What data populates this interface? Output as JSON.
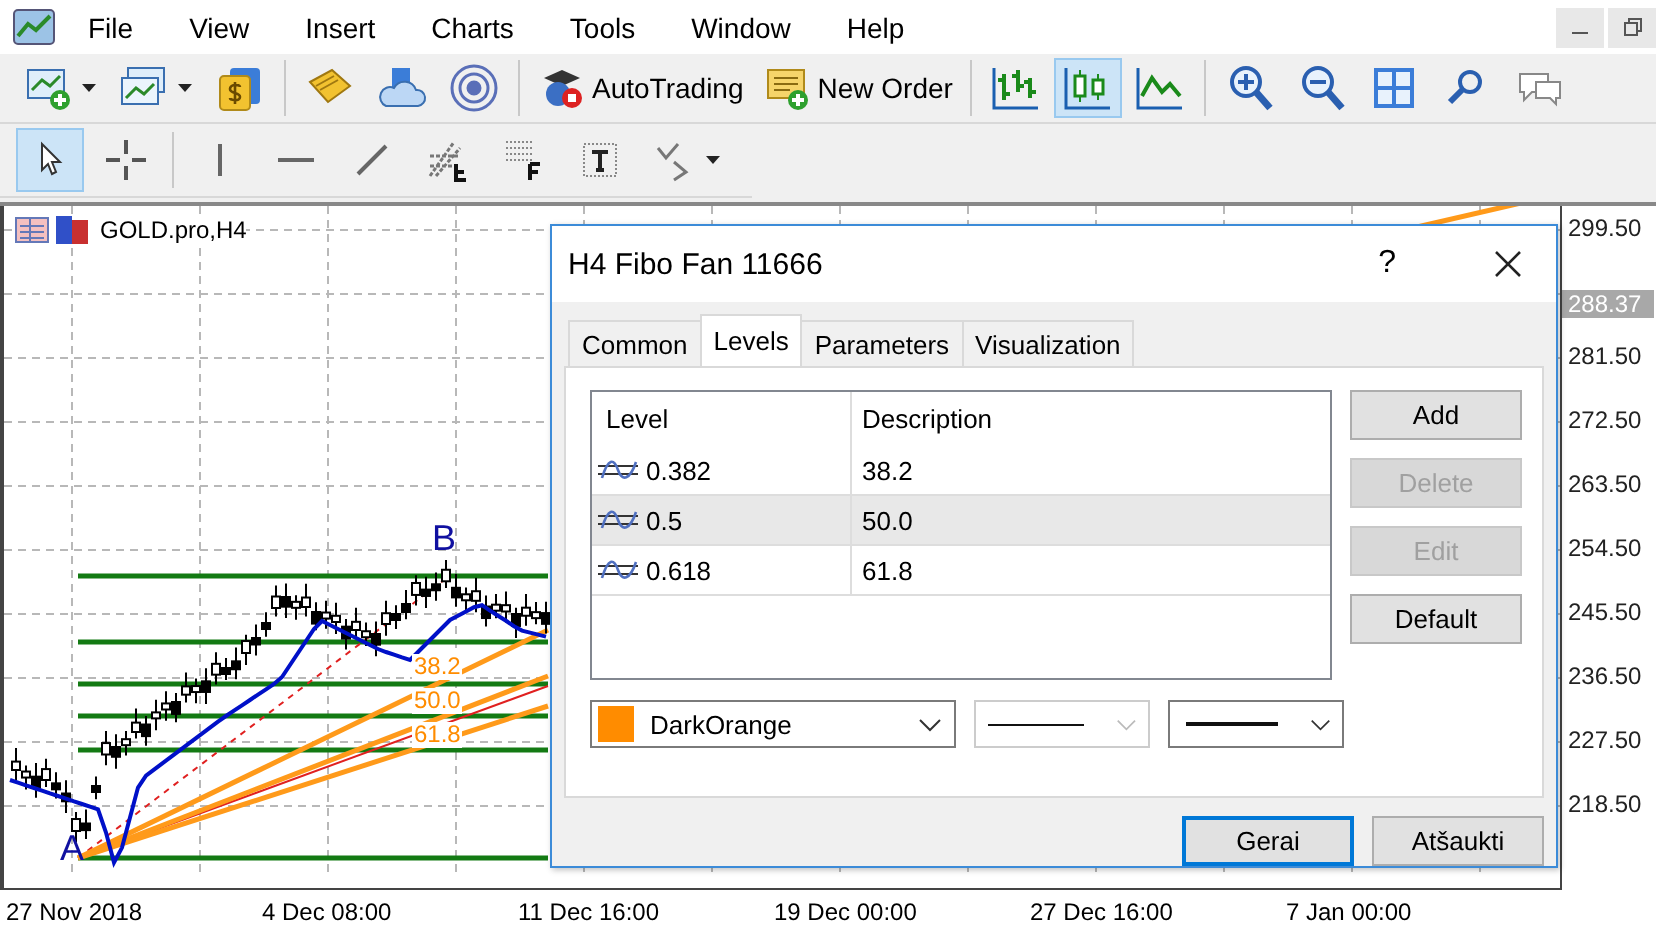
{
  "menu": [
    "File",
    "View",
    "Insert",
    "Charts",
    "Tools",
    "Window",
    "Help"
  ],
  "toolbar": [
    {
      "kind": "new-chart",
      "selected": false
    },
    {
      "kind": "profiles",
      "selected": false
    },
    {
      "kind": "market",
      "selected": false
    },
    {
      "kind": "sep"
    },
    {
      "kind": "history",
      "selected": false
    },
    {
      "kind": "cloud",
      "selected": false
    },
    {
      "kind": "signal",
      "selected": false
    },
    {
      "kind": "sep"
    },
    {
      "kind": "autotrading",
      "label": "AutoTrading",
      "selected": false
    },
    {
      "kind": "neworder",
      "label": "New Order",
      "selected": false
    },
    {
      "kind": "sep"
    },
    {
      "kind": "bars",
      "selected": false
    },
    {
      "kind": "candles",
      "selected": true
    },
    {
      "kind": "line",
      "selected": false
    },
    {
      "kind": "sep"
    },
    {
      "kind": "zoom-in",
      "selected": false
    },
    {
      "kind": "zoom-out",
      "selected": false
    },
    {
      "kind": "tile",
      "selected": false
    },
    {
      "kind": "search",
      "selected": false
    },
    {
      "kind": "chat",
      "selected": false
    }
  ],
  "tools": [
    {
      "kind": "cursor",
      "selected": true
    },
    {
      "kind": "crosshair",
      "selected": false
    },
    {
      "kind": "sep"
    },
    {
      "kind": "vline",
      "selected": false
    },
    {
      "kind": "hline",
      "selected": false
    },
    {
      "kind": "trend",
      "selected": false
    },
    {
      "kind": "fibo",
      "selected": false
    },
    {
      "kind": "grid",
      "selected": false
    },
    {
      "kind": "text",
      "selected": false
    },
    {
      "kind": "arrows",
      "selected": false
    }
  ],
  "chart": {
    "symbol": "GOLD.pro,H4",
    "point_a": "A",
    "point_b": "B",
    "fan_labels": [
      "38.2",
      "50.0",
      "61.8"
    ],
    "price_labels": [
      "299.50",
      "281.50",
      "272.50",
      "263.50",
      "254.50",
      "245.50",
      "236.50",
      "227.50",
      "218.50"
    ],
    "current_price": "288.37",
    "time_labels": [
      "27 Nov 2018",
      "4 Dec 08:00",
      "11 Dec 16:00",
      "19 Dec 00:00",
      "27 Dec 16:00",
      "7 Jan 00:00"
    ]
  },
  "dialog": {
    "title": "H4 Fibo Fan 11666",
    "help": "?",
    "tabs": [
      {
        "label": "Common",
        "selected": false
      },
      {
        "label": "Levels",
        "selected": true
      },
      {
        "label": "Parameters",
        "selected": false
      },
      {
        "label": "Visualization",
        "selected": false
      }
    ],
    "columns": [
      "Level",
      "Description"
    ],
    "rows": [
      {
        "level": "0.382",
        "description": "38.2",
        "selected": false
      },
      {
        "level": "0.5",
        "description": "50.0",
        "selected": true
      },
      {
        "level": "0.618",
        "description": "61.8",
        "selected": false
      }
    ],
    "side_buttons": [
      {
        "label": "Add",
        "disabled": false
      },
      {
        "label": "Delete",
        "disabled": true
      },
      {
        "label": "Edit",
        "disabled": true
      },
      {
        "label": "Default",
        "disabled": false
      }
    ],
    "color": {
      "name": "DarkOrange",
      "color": "#ff8c00"
    },
    "style_disabled": true,
    "buttons": [
      {
        "label": "Gerai",
        "default": true
      },
      {
        "label": "Atšaukti",
        "default": false
      }
    ]
  }
}
